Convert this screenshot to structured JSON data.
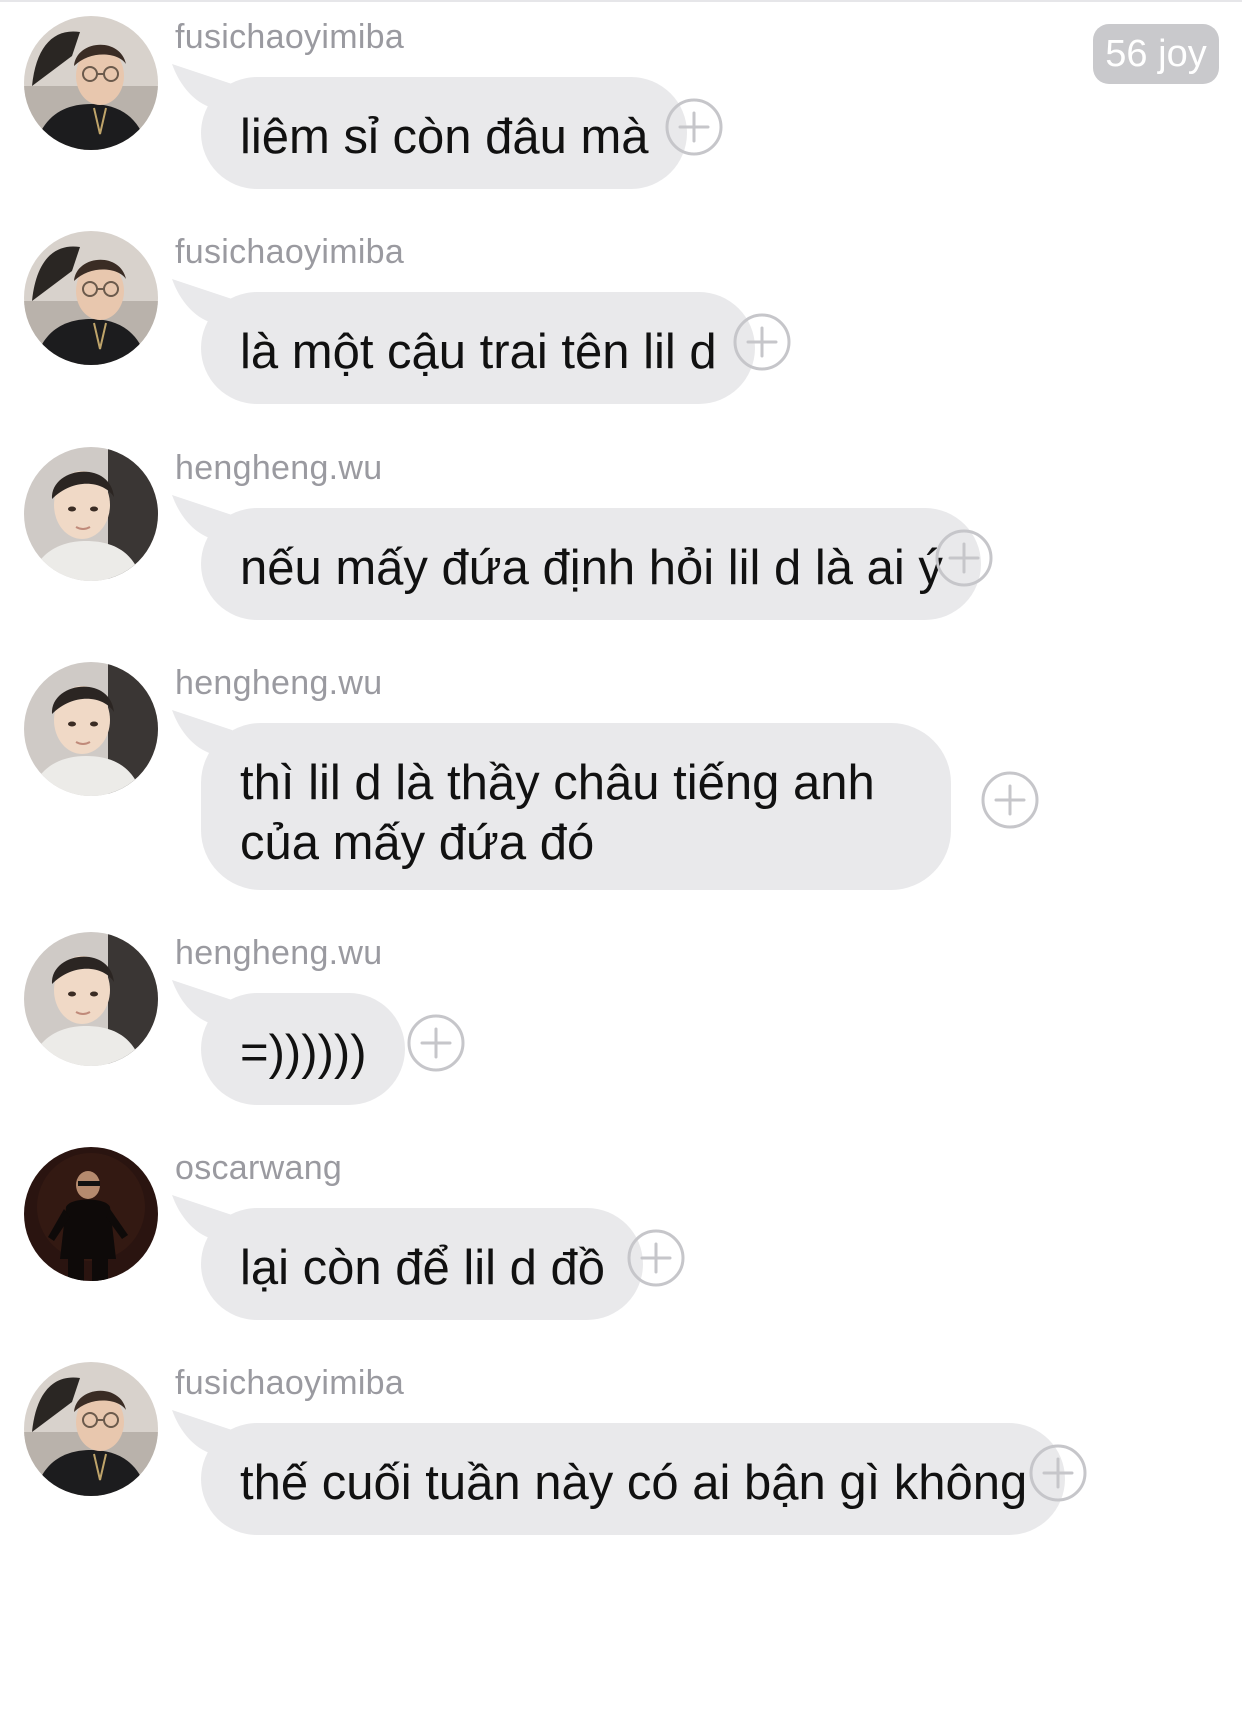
{
  "badge": {
    "text": "56 joy"
  },
  "colors": {
    "bubble": "#e9e9eb",
    "sender": "#9a9aa0",
    "text": "#111111",
    "icon": "#c6c6ca",
    "badge": "#c9c9cc"
  },
  "messages": [
    {
      "sender": "fusichaoyimiba",
      "avatar": "avatar-glasses-icon",
      "text": "liêm sỉ còn đâu mà"
    },
    {
      "sender": "fusichaoyimiba",
      "avatar": "avatar-glasses-icon",
      "text": "là một cậu trai tên lil d"
    },
    {
      "sender": "hengheng.wu",
      "avatar": "avatar-light-icon",
      "text": "nếu mấy đứa định hỏi lil d là ai ý"
    },
    {
      "sender": "hengheng.wu",
      "avatar": "avatar-light-icon",
      "text": "thì lil d là thầy châu tiếng anh của mấy đứa đó"
    },
    {
      "sender": "hengheng.wu",
      "avatar": "avatar-light-icon",
      "text": "=))))))"
    },
    {
      "sender": "oscarwang",
      "avatar": "avatar-dark-icon",
      "text": "lại còn để lil d đồ"
    },
    {
      "sender": "fusichaoyimiba",
      "avatar": "avatar-glasses-icon",
      "text": "thế cuối tuần này có ai bận gì không"
    }
  ]
}
